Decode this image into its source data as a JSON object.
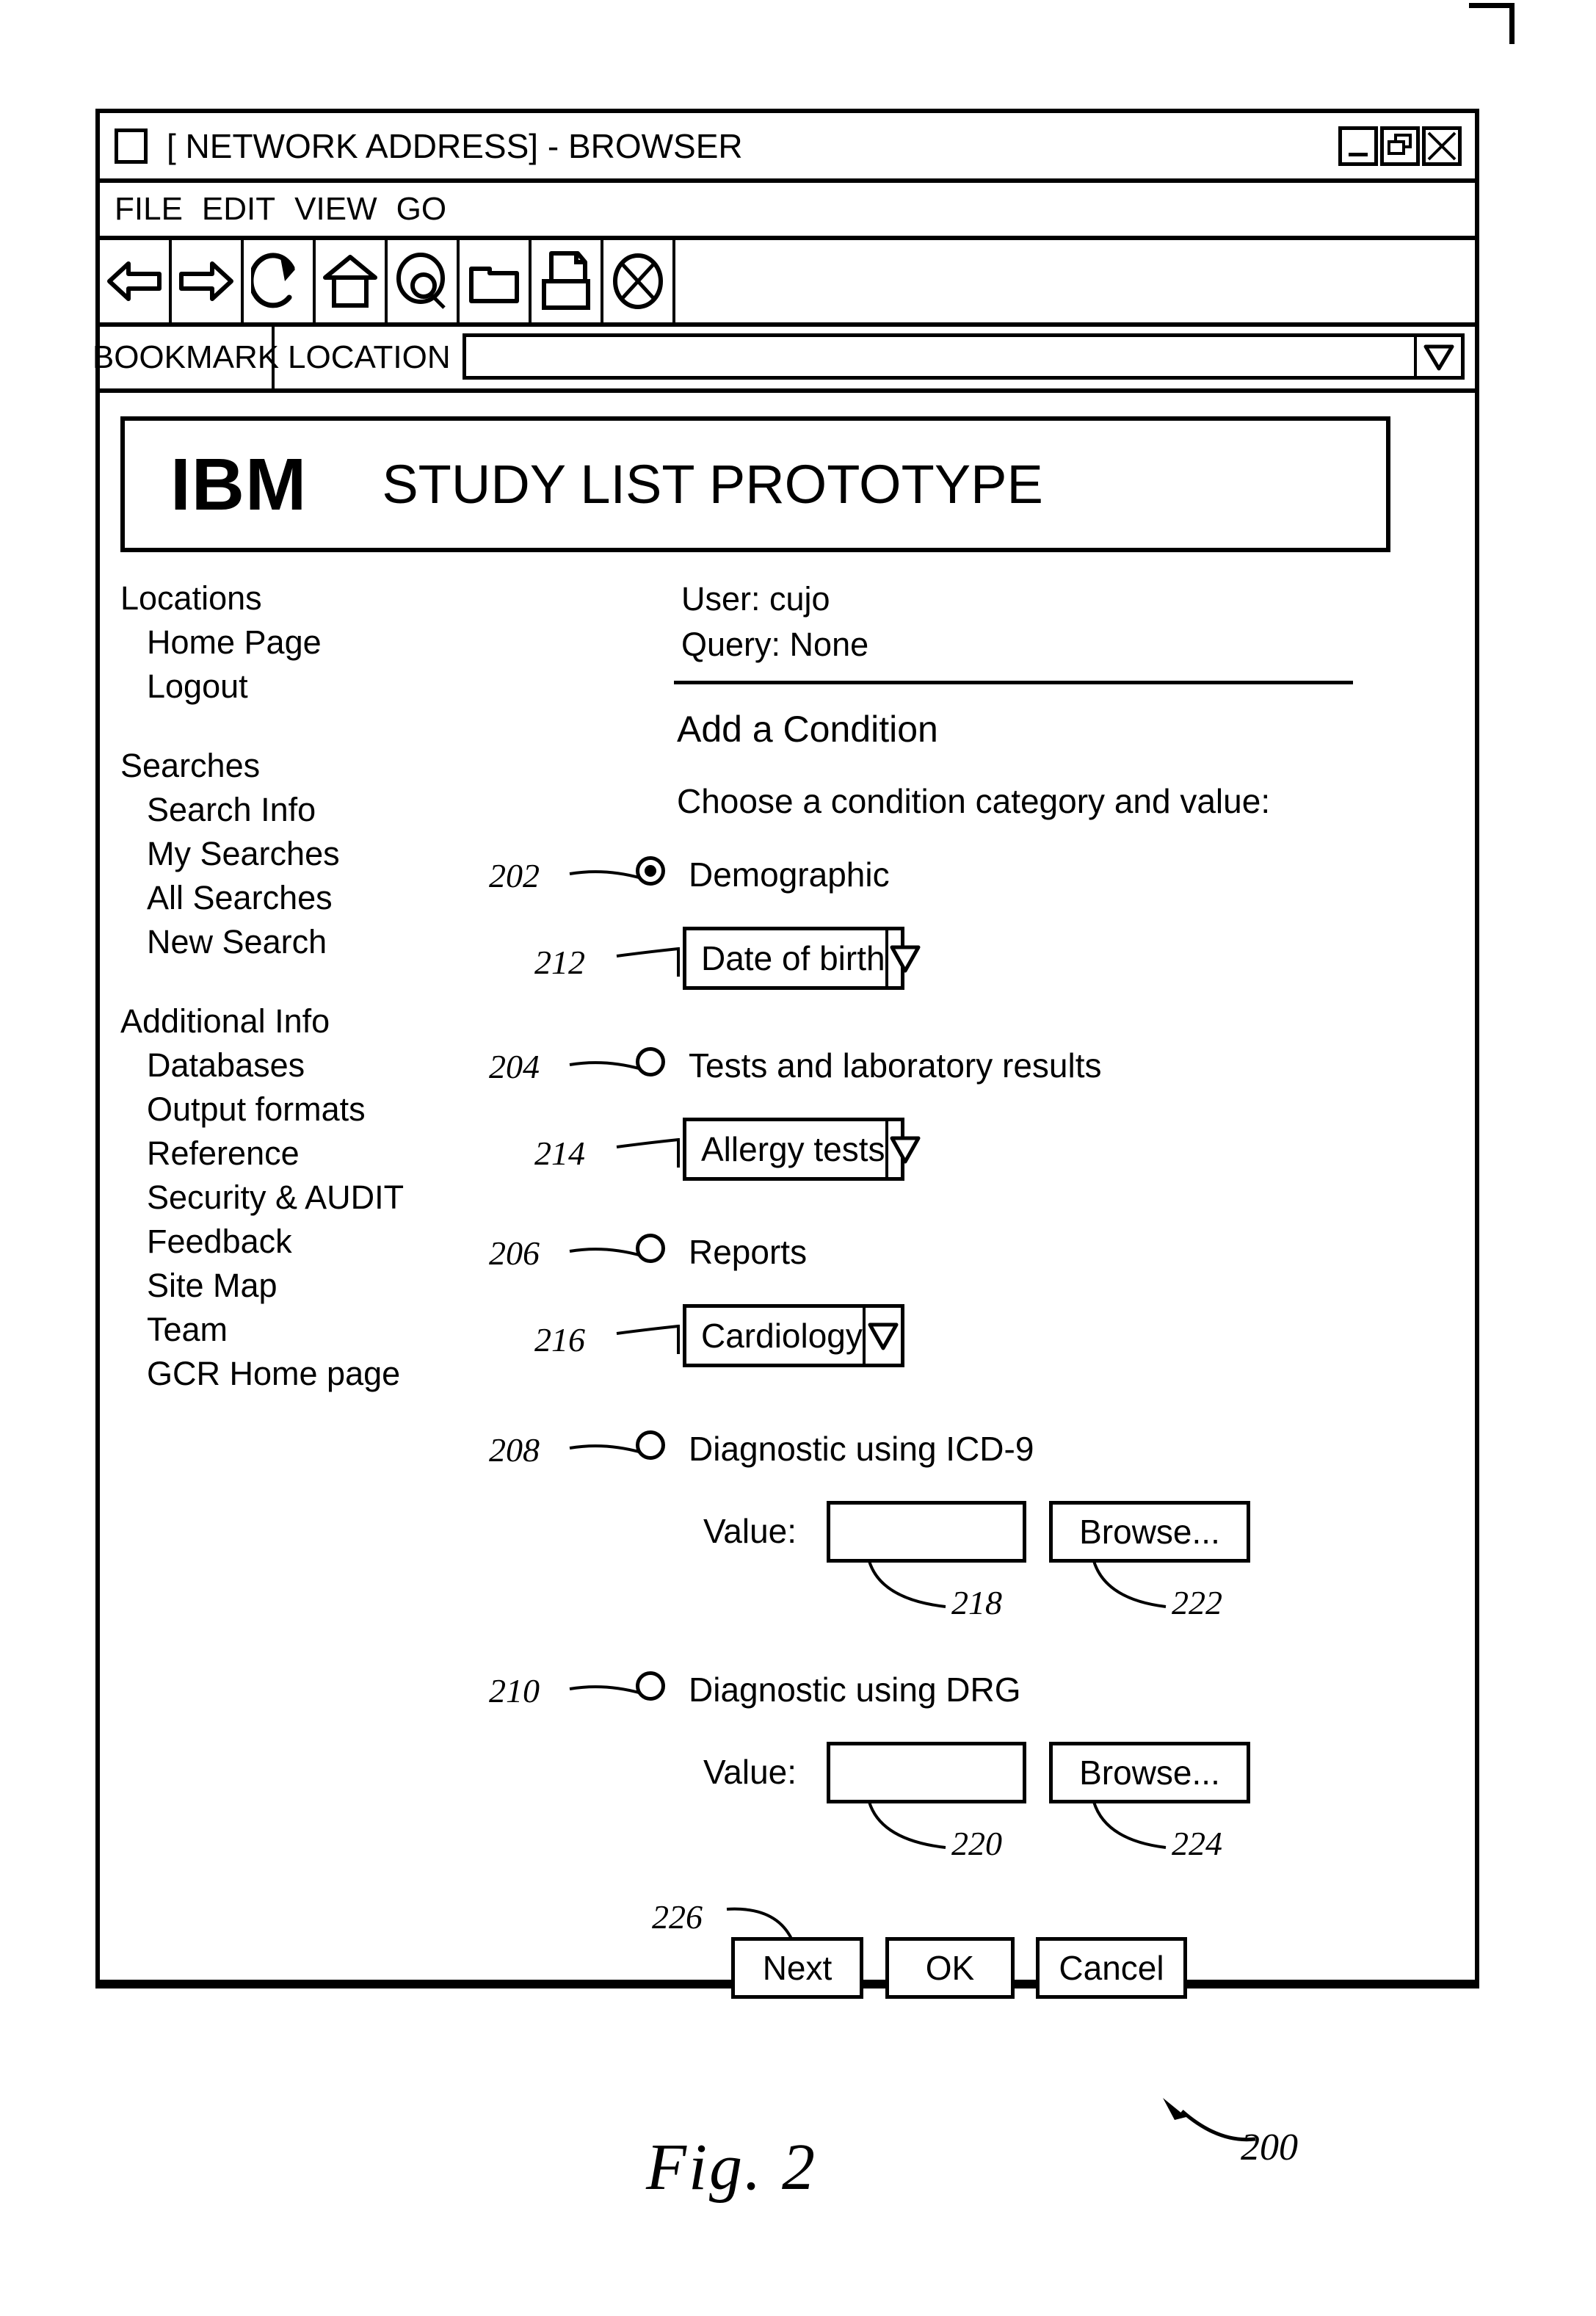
{
  "window": {
    "title": "[ NETWORK ADDRESS] - BROWSER",
    "controls": {
      "minimize": "minimize",
      "restore": "restore",
      "close": "close"
    }
  },
  "menu": {
    "items": [
      "FILE",
      "EDIT",
      "VIEW",
      "GO"
    ]
  },
  "toolbar": {
    "icons": [
      "back-arrow-icon",
      "forward-arrow-icon",
      "reload-icon",
      "home-icon",
      "search-icon",
      "folder-icon",
      "print-icon",
      "stop-icon"
    ]
  },
  "location_bar": {
    "bookmark_label": "BOOKMARK",
    "location_label": "LOCATION",
    "location_value": "",
    "location_placeholder": ""
  },
  "banner": {
    "logo": "IBM",
    "title": "STUDY LIST PROTOTYPE"
  },
  "sidebar": {
    "groups": [
      {
        "heading": "Locations",
        "links": [
          "Home Page",
          "Logout"
        ]
      },
      {
        "heading": "Searches",
        "links": [
          "Search Info",
          "My Searches",
          "All Searches",
          "New Search"
        ]
      },
      {
        "heading": "Additional Info",
        "links": [
          "Databases",
          "Output formats",
          "Reference",
          "Security & AUDIT",
          "Feedback",
          "Site Map",
          "Team",
          "GCR Home page"
        ]
      }
    ]
  },
  "main": {
    "user_line": "User: cujo",
    "query_line": "Query: None",
    "section_title": "Add a Condition",
    "prompt": "Choose a condition category and value:",
    "options": [
      {
        "ref": "202",
        "label": "Demographic",
        "selected": true,
        "control": {
          "ref": "212",
          "type": "dropdown",
          "value": "Date of birth"
        }
      },
      {
        "ref": "204",
        "label": "Tests and laboratory results",
        "selected": false,
        "control": {
          "ref": "214",
          "type": "dropdown",
          "value": "Allergy tests"
        }
      },
      {
        "ref": "206",
        "label": "Reports",
        "selected": false,
        "control": {
          "ref": "216",
          "type": "dropdown",
          "value": "Cardiology"
        }
      },
      {
        "ref": "208",
        "label": "Diagnostic using ICD-9",
        "selected": false,
        "control": {
          "type": "value-browse",
          "value_label": "Value:",
          "value_text": "",
          "value_ref": "218",
          "browse_label": "Browse...",
          "browse_ref": "222"
        }
      },
      {
        "ref": "210",
        "label": "Diagnostic using DRG",
        "selected": false,
        "control": {
          "type": "value-browse",
          "value_label": "Value:",
          "value_text": "",
          "value_ref": "220",
          "browse_label": "Browse...",
          "browse_ref": "224"
        }
      }
    ],
    "actions": {
      "ref": "226",
      "next_label": "Next",
      "ok_label": "OK",
      "cancel_label": "Cancel"
    }
  },
  "figure": {
    "caption": "Fig.  2",
    "ref": "200"
  }
}
